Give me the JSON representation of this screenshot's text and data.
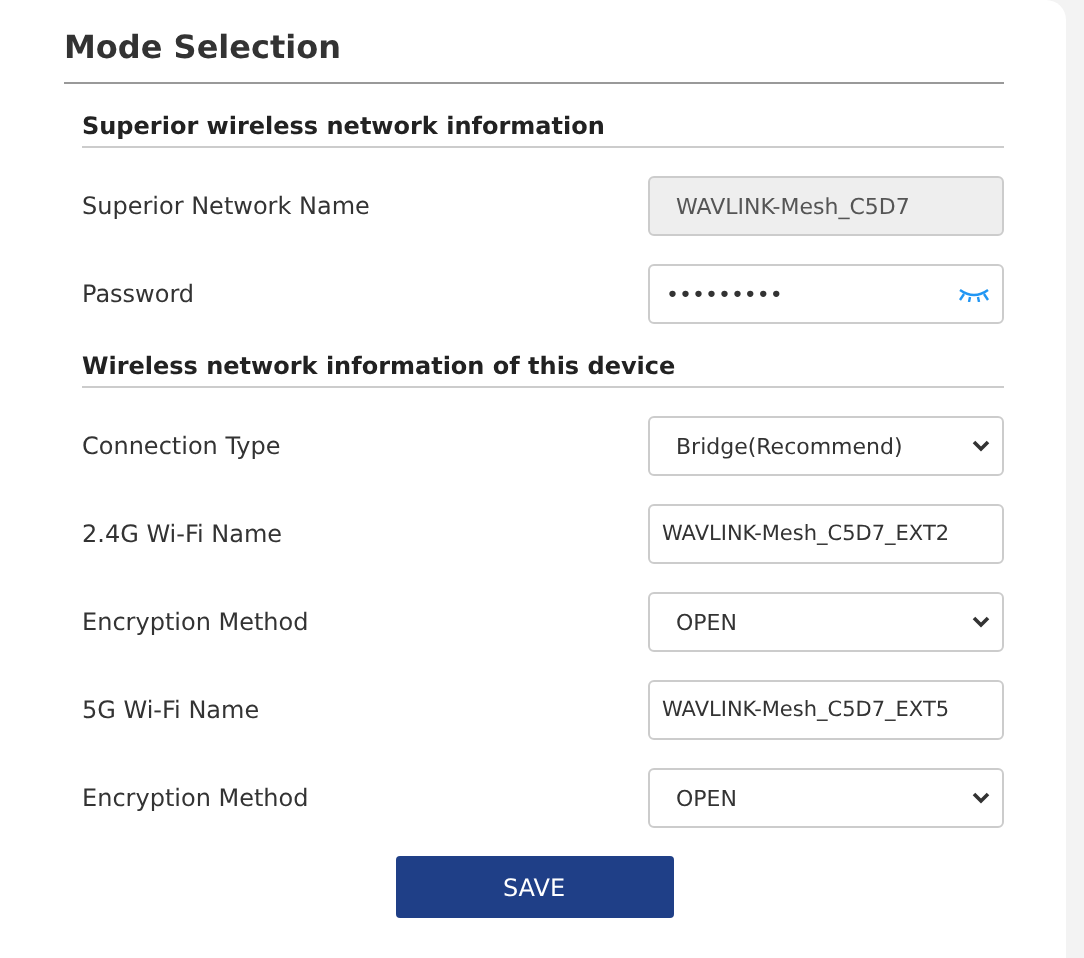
{
  "title": "Mode Selection",
  "sections": [
    {
      "heading": "Superior wireless network information",
      "fields": [
        {
          "label": "Superior Network Name",
          "kind": "text",
          "value": "WAVLINK-Mesh_C5D7",
          "disabled": true
        },
        {
          "label": "Password",
          "kind": "password",
          "value": "•••••••••",
          "disabled": false
        }
      ]
    },
    {
      "heading": "Wireless network information of this device",
      "fields": [
        {
          "label": "Connection Type",
          "kind": "select",
          "value": "Bridge(Recommend)",
          "disabled": false
        },
        {
          "label": "2.4G Wi-Fi Name",
          "kind": "text",
          "value": "WAVLINK-Mesh_C5D7_EXT2",
          "disabled": false
        },
        {
          "label": "Encryption Method",
          "kind": "select",
          "value": "OPEN",
          "disabled": false
        },
        {
          "label": "5G Wi-Fi Name",
          "kind": "text",
          "value": "WAVLINK-Mesh_C5D7_EXT5",
          "disabled": false
        },
        {
          "label": "Encryption Method",
          "kind": "select",
          "value": "OPEN",
          "disabled": false
        }
      ]
    }
  ],
  "save_button": "SAVE"
}
